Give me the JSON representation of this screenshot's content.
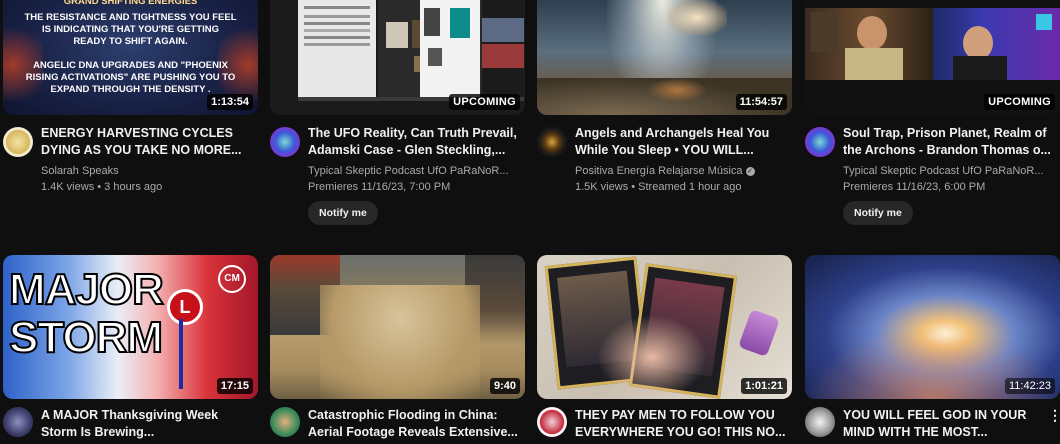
{
  "row1": [
    {
      "thumb_lines": [
        "GRAND SHIFTING ENERGIES",
        "THE RESISTANCE AND TIGHTNESS YOU FEEL",
        "IS INDICATING THAT YOU'RE GETTING",
        "READY TO SHIFT AGAIN.",
        "ANGELIC DNA UPGRADES AND \"PHOENIX",
        "RISING ACTIVATIONS\" ARE PUSHING YOU TO",
        "EXPAND THROUGH THE DENSITY ."
      ],
      "badge": "1:13:54",
      "title": "ENERGY HARVESTING CYCLES DYING AS YOU TAKE NO MORE...",
      "channel": "Solarah Speaks",
      "info": "1.4K views • 3 hours ago"
    },
    {
      "badge": "UPCOMING",
      "title": "The UFO Reality, Can Truth Prevail, Adamski Case - Glen Steckling,...",
      "channel": "Typical Skeptic Podcast UfO PaRaNoR...",
      "info": "Premieres 11/16/23, 7:00 PM",
      "notify": "Notify me"
    },
    {
      "badge": "11:54:57",
      "title": "Angels and Archangels Heal You While You Sleep • YOU WILL...",
      "channel": "Positiva Energía Relajarse Música",
      "info": "1.5K views • Streamed 1 hour ago"
    },
    {
      "badge": "UPCOMING",
      "title": "Soul Trap, Prison Planet, Realm of the Archons - Brandon Thomas o...",
      "channel": "Typical Skeptic Podcast UfO PaRaNoR...",
      "info": "Premieres 11/16/23, 6:00 PM",
      "notify": "Notify me"
    }
  ],
  "row2": [
    {
      "thumb_big": "MAJOR STORM",
      "thumb_big_1": "MAJOR",
      "thumb_big_2": "STORM",
      "thumb_l": "L",
      "thumb_logo": "CM",
      "badge": "17:15",
      "title": "A MAJOR Thanksgiving Week Storm Is Brewing..."
    },
    {
      "badge": "9:40",
      "title": "Catastrophic Flooding in China: Aerial Footage Reveals Extensive..."
    },
    {
      "badge": "1:01:21",
      "title": "THEY PAY MEN TO FOLLOW YOU EVERYWHERE YOU GO! THIS NO..."
    },
    {
      "badge": "11:42:23",
      "title": "YOU WILL FEEL GOD IN YOUR MIND WITH THE MOST..."
    }
  ],
  "icons": {
    "more": "more-vert-icon",
    "verified": "verified-check-icon"
  }
}
